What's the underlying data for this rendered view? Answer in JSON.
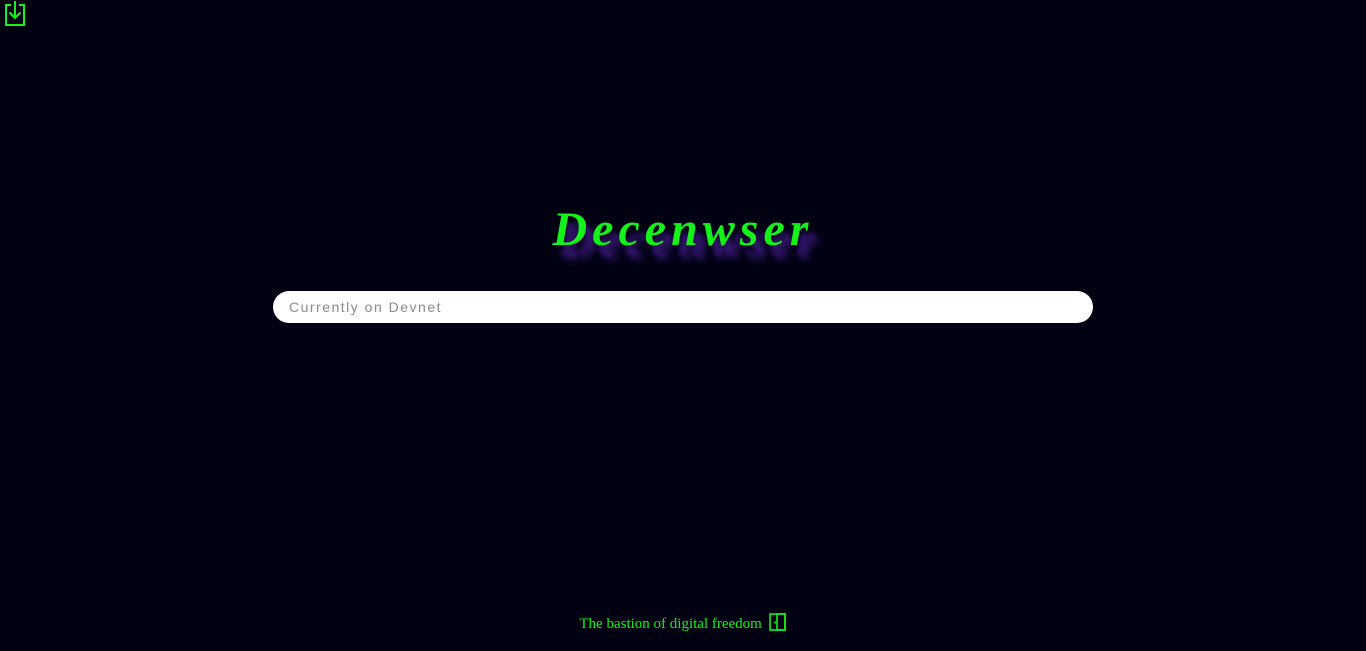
{
  "toolbar": {
    "download_icon": "download-icon"
  },
  "brand": {
    "title": "Decenwser"
  },
  "search": {
    "placeholder": "Currently on Devnet",
    "value": ""
  },
  "footer": {
    "tagline": "The bastion of digital freedom",
    "door_icon": "door-icon"
  },
  "colors": {
    "background": "#000212",
    "accent": "#14f21a",
    "title_shadow": "#3a1a78",
    "search_bg": "#ffffff",
    "placeholder": "#8a8a8a"
  }
}
